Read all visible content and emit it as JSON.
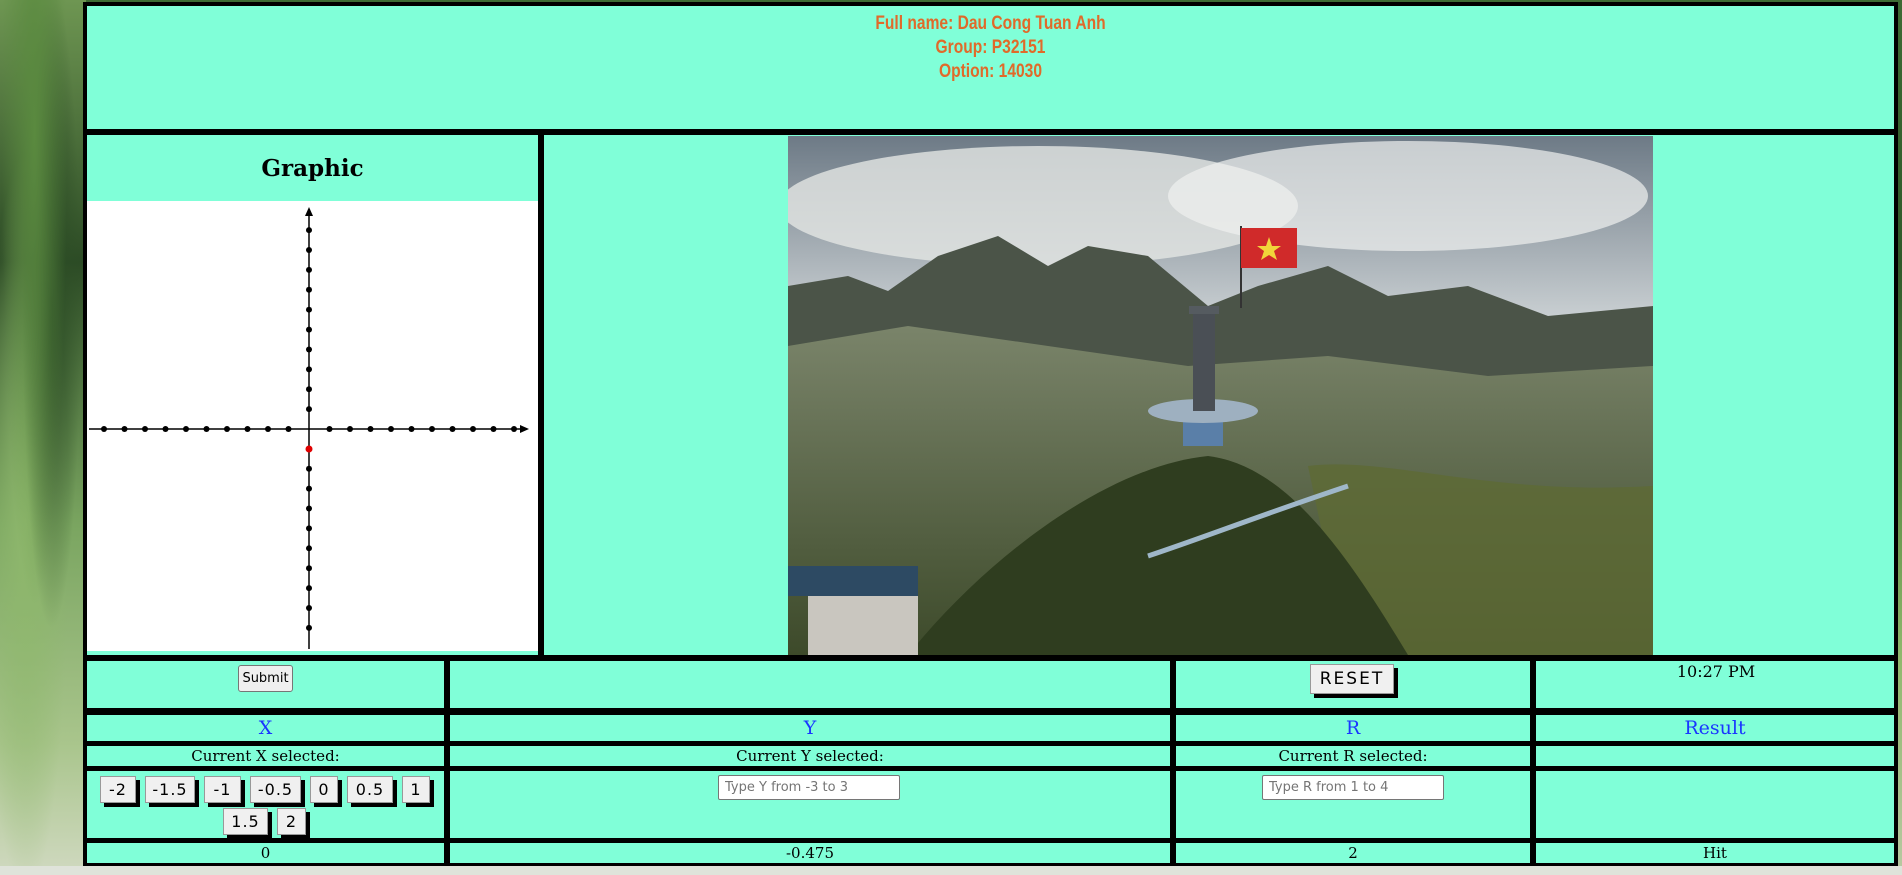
{
  "header": {
    "full_name": "Full name: Dau Cong Tuan Anh",
    "group": "Group: P32151",
    "option": "Option: 14030"
  },
  "graphic": {
    "title": "Graphic",
    "point_color": "#e00000"
  },
  "photo": {
    "subject": "flag-tower-on-mountain-photo"
  },
  "controls": {
    "submit_label": "Submit",
    "reset_label": "RESET",
    "time": "10:27 PM"
  },
  "columns": {
    "x": "X",
    "y": "Y",
    "r": "R",
    "result": "Result"
  },
  "current": {
    "x_label": "Current X selected:",
    "y_label": "Current Y selected:",
    "r_label": "Current R selected:"
  },
  "x_options": [
    "-2",
    "-1.5",
    "-1",
    "-0.5",
    "0",
    "0.5",
    "1",
    "1.5",
    "2"
  ],
  "inputs": {
    "y_placeholder": "Type Y from -3 to 3",
    "r_placeholder": "Type R from 1 to 4"
  },
  "values": {
    "x": "0",
    "y": "-0.475",
    "r": "2",
    "result": "Hit"
  },
  "colors": {
    "cell_background": "#80ffd8",
    "header_text": "#e06a2a",
    "column_header_text": "#1a36ff"
  }
}
